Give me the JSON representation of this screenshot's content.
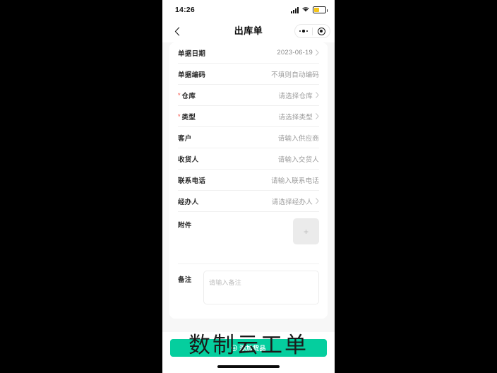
{
  "status_bar": {
    "time": "14:26",
    "signal_icon": "signal-bars-icon",
    "wifi_icon": "wifi-icon",
    "battery_icon": "battery-icon"
  },
  "nav": {
    "back_icon": "chevron-left-icon",
    "title": "出库单",
    "menu_icon": "more-dots-icon",
    "target_icon": "target-circle-icon"
  },
  "colors": {
    "accent_green": "#05CE9E",
    "required_red": "#F5473C",
    "page_bg": "#F7F7F7",
    "card_bg": "#FFFFFF",
    "placeholder": "#9A9A9A"
  },
  "form": {
    "rows": [
      {
        "label": "单据日期",
        "value": "2023-06-19",
        "required": false,
        "chevron": true,
        "filled": true
      },
      {
        "label": "单据编码",
        "value": "不填则自动编码",
        "required": false,
        "chevron": false,
        "filled": false
      },
      {
        "label": "仓库",
        "value": "请选择仓库",
        "required": true,
        "chevron": true,
        "filled": false
      },
      {
        "label": "类型",
        "value": "请选择类型",
        "required": true,
        "chevron": true,
        "filled": false
      },
      {
        "label": "客户",
        "value": "请输入供应商",
        "required": false,
        "chevron": false,
        "filled": false
      },
      {
        "label": "收货人",
        "value": "请输入交货人",
        "required": false,
        "chevron": false,
        "filled": false
      },
      {
        "label": "联系电话",
        "value": "请输入联系电话",
        "required": false,
        "chevron": false,
        "filled": false
      },
      {
        "label": "经办人",
        "value": "请选择经办人",
        "required": false,
        "chevron": true,
        "filled": false
      }
    ],
    "attachment": {
      "label": "附件",
      "upload_icon": "plus-icon",
      "plus_glyph": "+"
    },
    "remark": {
      "label": "备注",
      "placeholder": "请输入备注",
      "value": ""
    }
  },
  "bottom": {
    "add_icon": "plus-circle-icon",
    "add_label": "添加货品",
    "home_indicator": "home-indicator"
  },
  "watermark": {
    "text": "数制云工单"
  }
}
